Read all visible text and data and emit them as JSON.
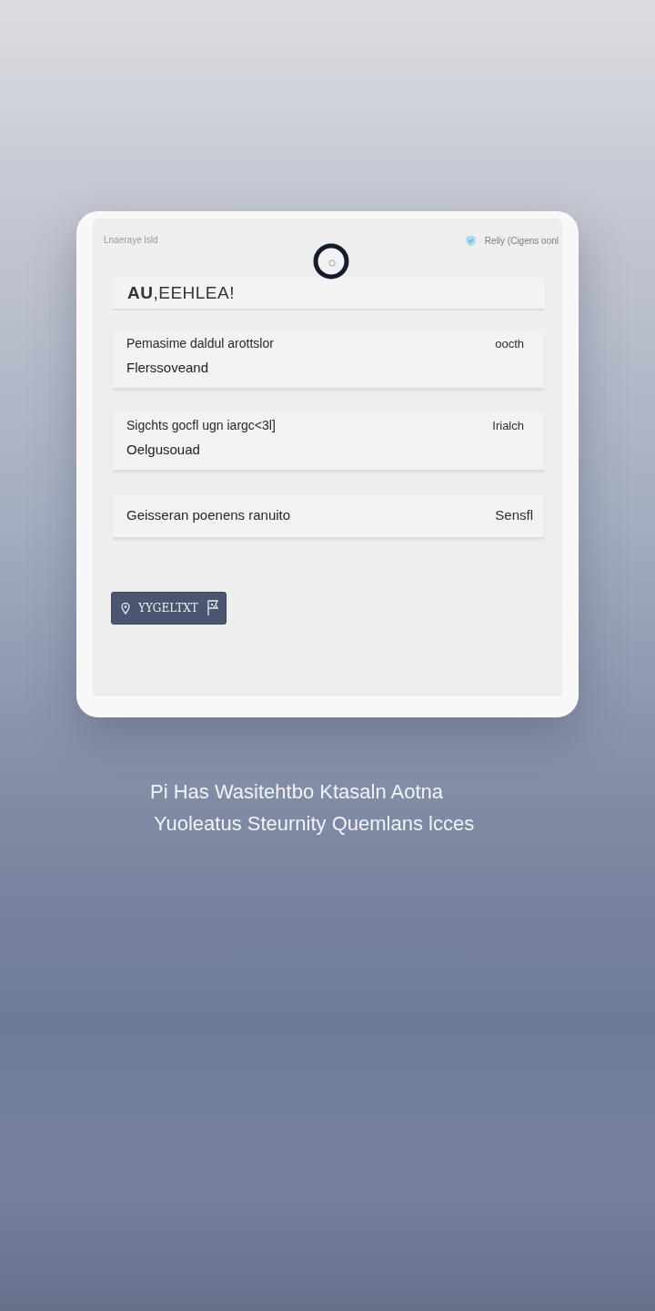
{
  "card": {
    "top_left_text": "Lnaeraye lsld",
    "top_right_text": "Reliy (Cigens oonl",
    "heading": "**AU**,EEHLEA!",
    "fields": [
      {
        "label": "Pemasime daldul arottslor",
        "action": "oocth",
        "value": "Flerssoveand"
      },
      {
        "label": "Sigchts gocfl ugn iargc<3l]",
        "action": "Irialch",
        "value": "Oelgusouad"
      },
      {
        "label": "Geisseran poenens ranuito",
        "action": "Sensfl"
      }
    ],
    "button": {
      "label": "YYGELTXT"
    }
  },
  "caption": [
    "Pi Has Wasitehtbo Ktasaln Aotna",
    "Yuoleatus Steurnity Quemlans lcces"
  ]
}
